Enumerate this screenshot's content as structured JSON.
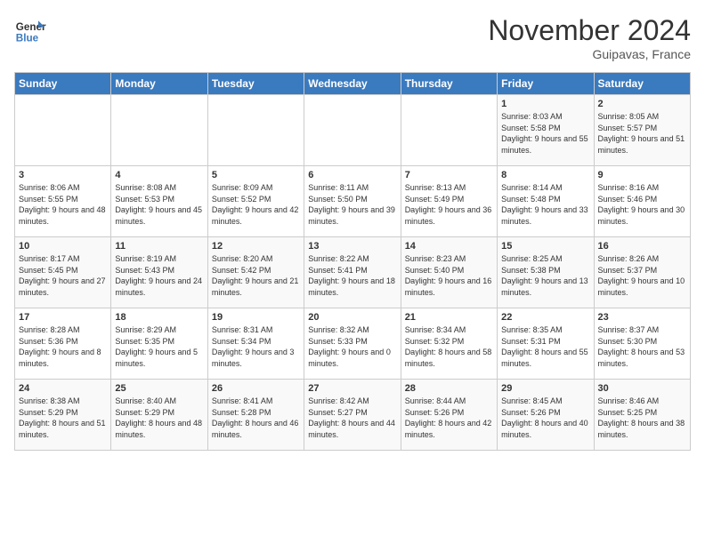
{
  "header": {
    "logo_line1": "General",
    "logo_line2": "Blue",
    "month": "November 2024",
    "location": "Guipavas, France"
  },
  "weekdays": [
    "Sunday",
    "Monday",
    "Tuesday",
    "Wednesday",
    "Thursday",
    "Friday",
    "Saturday"
  ],
  "weeks": [
    [
      {
        "day": "",
        "info": ""
      },
      {
        "day": "",
        "info": ""
      },
      {
        "day": "",
        "info": ""
      },
      {
        "day": "",
        "info": ""
      },
      {
        "day": "",
        "info": ""
      },
      {
        "day": "1",
        "info": "Sunrise: 8:03 AM\nSunset: 5:58 PM\nDaylight: 9 hours and 55 minutes."
      },
      {
        "day": "2",
        "info": "Sunrise: 8:05 AM\nSunset: 5:57 PM\nDaylight: 9 hours and 51 minutes."
      }
    ],
    [
      {
        "day": "3",
        "info": "Sunrise: 8:06 AM\nSunset: 5:55 PM\nDaylight: 9 hours and 48 minutes."
      },
      {
        "day": "4",
        "info": "Sunrise: 8:08 AM\nSunset: 5:53 PM\nDaylight: 9 hours and 45 minutes."
      },
      {
        "day": "5",
        "info": "Sunrise: 8:09 AM\nSunset: 5:52 PM\nDaylight: 9 hours and 42 minutes."
      },
      {
        "day": "6",
        "info": "Sunrise: 8:11 AM\nSunset: 5:50 PM\nDaylight: 9 hours and 39 minutes."
      },
      {
        "day": "7",
        "info": "Sunrise: 8:13 AM\nSunset: 5:49 PM\nDaylight: 9 hours and 36 minutes."
      },
      {
        "day": "8",
        "info": "Sunrise: 8:14 AM\nSunset: 5:48 PM\nDaylight: 9 hours and 33 minutes."
      },
      {
        "day": "9",
        "info": "Sunrise: 8:16 AM\nSunset: 5:46 PM\nDaylight: 9 hours and 30 minutes."
      }
    ],
    [
      {
        "day": "10",
        "info": "Sunrise: 8:17 AM\nSunset: 5:45 PM\nDaylight: 9 hours and 27 minutes."
      },
      {
        "day": "11",
        "info": "Sunrise: 8:19 AM\nSunset: 5:43 PM\nDaylight: 9 hours and 24 minutes."
      },
      {
        "day": "12",
        "info": "Sunrise: 8:20 AM\nSunset: 5:42 PM\nDaylight: 9 hours and 21 minutes."
      },
      {
        "day": "13",
        "info": "Sunrise: 8:22 AM\nSunset: 5:41 PM\nDaylight: 9 hours and 18 minutes."
      },
      {
        "day": "14",
        "info": "Sunrise: 8:23 AM\nSunset: 5:40 PM\nDaylight: 9 hours and 16 minutes."
      },
      {
        "day": "15",
        "info": "Sunrise: 8:25 AM\nSunset: 5:38 PM\nDaylight: 9 hours and 13 minutes."
      },
      {
        "day": "16",
        "info": "Sunrise: 8:26 AM\nSunset: 5:37 PM\nDaylight: 9 hours and 10 minutes."
      }
    ],
    [
      {
        "day": "17",
        "info": "Sunrise: 8:28 AM\nSunset: 5:36 PM\nDaylight: 9 hours and 8 minutes."
      },
      {
        "day": "18",
        "info": "Sunrise: 8:29 AM\nSunset: 5:35 PM\nDaylight: 9 hours and 5 minutes."
      },
      {
        "day": "19",
        "info": "Sunrise: 8:31 AM\nSunset: 5:34 PM\nDaylight: 9 hours and 3 minutes."
      },
      {
        "day": "20",
        "info": "Sunrise: 8:32 AM\nSunset: 5:33 PM\nDaylight: 9 hours and 0 minutes."
      },
      {
        "day": "21",
        "info": "Sunrise: 8:34 AM\nSunset: 5:32 PM\nDaylight: 8 hours and 58 minutes."
      },
      {
        "day": "22",
        "info": "Sunrise: 8:35 AM\nSunset: 5:31 PM\nDaylight: 8 hours and 55 minutes."
      },
      {
        "day": "23",
        "info": "Sunrise: 8:37 AM\nSunset: 5:30 PM\nDaylight: 8 hours and 53 minutes."
      }
    ],
    [
      {
        "day": "24",
        "info": "Sunrise: 8:38 AM\nSunset: 5:29 PM\nDaylight: 8 hours and 51 minutes."
      },
      {
        "day": "25",
        "info": "Sunrise: 8:40 AM\nSunset: 5:29 PM\nDaylight: 8 hours and 48 minutes."
      },
      {
        "day": "26",
        "info": "Sunrise: 8:41 AM\nSunset: 5:28 PM\nDaylight: 8 hours and 46 minutes."
      },
      {
        "day": "27",
        "info": "Sunrise: 8:42 AM\nSunset: 5:27 PM\nDaylight: 8 hours and 44 minutes."
      },
      {
        "day": "28",
        "info": "Sunrise: 8:44 AM\nSunset: 5:26 PM\nDaylight: 8 hours and 42 minutes."
      },
      {
        "day": "29",
        "info": "Sunrise: 8:45 AM\nSunset: 5:26 PM\nDaylight: 8 hours and 40 minutes."
      },
      {
        "day": "30",
        "info": "Sunrise: 8:46 AM\nSunset: 5:25 PM\nDaylight: 8 hours and 38 minutes."
      }
    ]
  ]
}
